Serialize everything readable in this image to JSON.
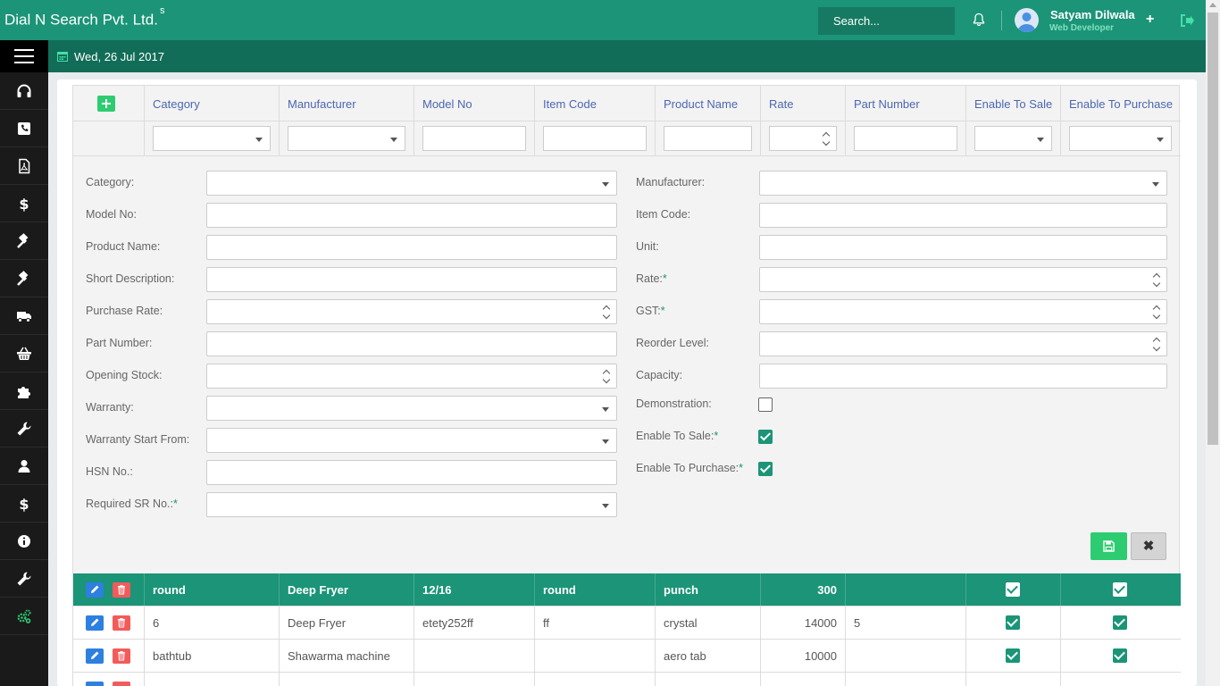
{
  "app": {
    "brand": "Dial N Search Pvt. Ltd.",
    "brand_sup": "s",
    "search_placeholder": "Search...",
    "user_name": "Satyam Dilwala",
    "user_role": "Web Developer",
    "date": "Wed, 26 Jul 2017"
  },
  "sidebar": {
    "icons": [
      "headphones-icon",
      "phone-icon",
      "pdf-icon",
      "dollar-icon",
      "gavel-icon",
      "gavel-icon-2",
      "truck-icon",
      "basket-icon",
      "puzzle-icon",
      "wrench-icon",
      "user-icon",
      "dollar-icon-2",
      "info-icon",
      "wrench-icon-2",
      "cogs-icon"
    ]
  },
  "grid": {
    "columns": [
      "Category",
      "Manufacturer",
      "Model No",
      "Item Code",
      "Product Name",
      "Rate",
      "Part Number",
      "Enable To Sale",
      "Enable To Purchase"
    ]
  },
  "form": {
    "left": [
      {
        "label": "Category:",
        "type": "select"
      },
      {
        "label": "Model No:",
        "type": "text"
      },
      {
        "label": "Product Name:",
        "type": "text"
      },
      {
        "label": "Short Description:",
        "type": "text"
      },
      {
        "label": "Purchase Rate:",
        "type": "number"
      },
      {
        "label": "Part Number:",
        "type": "text"
      },
      {
        "label": "Opening Stock:",
        "type": "number"
      },
      {
        "label": "Warranty:",
        "type": "select"
      },
      {
        "label": "Warranty Start From:",
        "type": "select"
      },
      {
        "label": "HSN No.:",
        "type": "text"
      },
      {
        "label": "Required SR No.:",
        "type": "select",
        "required": true
      }
    ],
    "right": [
      {
        "label": "Manufacturer:",
        "type": "select"
      },
      {
        "label": "Item Code:",
        "type": "text"
      },
      {
        "label": "Unit:",
        "type": "text"
      },
      {
        "label": "Rate:",
        "type": "number",
        "required": true
      },
      {
        "label": "GST:",
        "type": "number",
        "required": true
      },
      {
        "label": "Reorder Level:",
        "type": "number"
      },
      {
        "label": "Capacity:",
        "type": "text"
      },
      {
        "label": "Demonstration:",
        "type": "checkbox",
        "checked": false
      },
      {
        "label": "Enable To Sale:",
        "type": "checkbox",
        "checked": true,
        "required": true
      },
      {
        "label": "Enable To Purchase:",
        "type": "checkbox",
        "checked": true,
        "required": true
      }
    ],
    "cancel_label": "✖"
  },
  "rows": [
    {
      "category": "round",
      "manufacturer": "Deep Fryer",
      "model_no": "12/16",
      "item_code": "round",
      "product_name": "punch",
      "rate": "300",
      "part_number": "",
      "sale": true,
      "purchase": true,
      "highlighted": true
    },
    {
      "category": "6",
      "manufacturer": "Deep Fryer",
      "model_no": "etety252ff",
      "item_code": "ff",
      "product_name": "crystal",
      "rate": "14000",
      "part_number": "5",
      "sale": true,
      "purchase": true,
      "highlighted": false
    },
    {
      "category": "bathtub",
      "manufacturer": "Shawarma machine",
      "model_no": "",
      "item_code": "",
      "product_name": "aero tab",
      "rate": "10000",
      "part_number": "",
      "sale": true,
      "purchase": true,
      "highlighted": false
    }
  ]
}
